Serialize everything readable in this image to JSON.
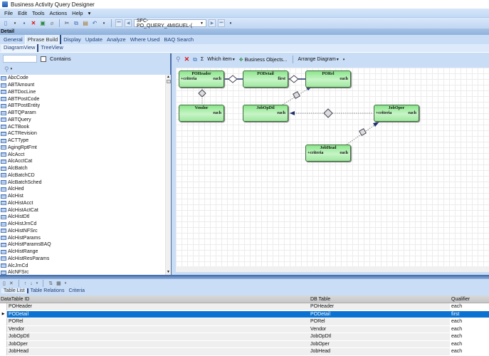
{
  "window": {
    "title": "Business Activity Query Designer"
  },
  "menu": [
    "File",
    "Edit",
    "Tools",
    "Actions",
    "Help"
  ],
  "toolbar": {
    "icons": [
      "new-icon",
      "save-icon",
      "delete-icon",
      "refresh-icon",
      "clear-icon",
      "cut-icon",
      "copy-icon",
      "paste-icon",
      "undo-icon"
    ],
    "query_select_value": "SFC-PO_QUERY_4MIGUEL-("
  },
  "detail_label": "Detail",
  "main_tabs": [
    {
      "label": "General",
      "active": false
    },
    {
      "label": "Phrase Build",
      "active": true
    },
    {
      "label": "Display",
      "active": false
    },
    {
      "label": "Update",
      "active": false
    },
    {
      "label": "Analyze",
      "active": false
    },
    {
      "label": "Where Used",
      "active": false
    },
    {
      "label": "BAQ Search",
      "active": false
    }
  ],
  "view_tabs": [
    {
      "label": "DiagramView",
      "active": true
    },
    {
      "label": "TreeView",
      "active": false
    }
  ],
  "left_panel": {
    "search_value": "",
    "contains_label": "Contains",
    "contains_checked": false,
    "tables": [
      "AbcCode",
      "ABTAmount",
      "ABTDocLine",
      "ABTPostCode",
      "ABTPostEntity",
      "ABTQParam",
      "ABTQuery",
      "ACTBook",
      "ACTRevision",
      "ACTType",
      "AgingRptFmt",
      "AlcAcct",
      "AlcAcctCat",
      "AlcBatch",
      "AlcBatchCD",
      "AlcBatchSched",
      "AlcHed",
      "AlcHist",
      "AlcHistAcct",
      "AlcHistActCat",
      "AlcHistDtl",
      "AlcHistJrnCd",
      "AlcHistNFSrc",
      "AlcHistParams",
      "AlcHistParamsBAQ",
      "AlcHistRange",
      "AlcHistResParams",
      "AlcJrnCd",
      "AlcNFSrc"
    ]
  },
  "canvas_toolbar": {
    "sum_symbol": "Σ",
    "which_item": "Which item",
    "business_objects": "Business Objects...",
    "arrange_diagram": "Arrange Diagram"
  },
  "diagram": {
    "nodes": [
      {
        "id": "POHeader",
        "title": "POHeader",
        "left": "+criteria",
        "right": "each"
      },
      {
        "id": "PODetail",
        "title": "PODetail",
        "left": "",
        "right": "first"
      },
      {
        "id": "PORel",
        "title": "PORel",
        "left": "",
        "right": "each"
      },
      {
        "id": "Vendor",
        "title": "Vendor",
        "left": "",
        "right": "each"
      },
      {
        "id": "JobOpDtl",
        "title": "JobOpDtl",
        "left": "",
        "right": "each"
      },
      {
        "id": "JobOper",
        "title": "JobOper",
        "left": "+criteria",
        "right": "each"
      },
      {
        "id": "JobHead",
        "title": "JobHead",
        "left": "+criteria",
        "right": "each"
      }
    ]
  },
  "bottom_tabs": [
    {
      "label": "Table List",
      "active": true
    },
    {
      "label": "Table Relations",
      "active": false
    },
    {
      "label": "Criteria",
      "active": false
    }
  ],
  "grid": {
    "headers": [
      "DataTable ID",
      "DB Table",
      "Qualifier"
    ],
    "rows": [
      {
        "id": "POHeader",
        "db": "POHeader",
        "q": "each",
        "selected": false
      },
      {
        "id": "PODetail",
        "db": "PODetail",
        "q": "first",
        "selected": true
      },
      {
        "id": "PORel",
        "db": "PORel",
        "q": "each",
        "selected": false
      },
      {
        "id": "Vendor",
        "db": "Vendor",
        "q": "each",
        "selected": false
      },
      {
        "id": "JobOpDtl",
        "db": "JobOpDtl",
        "q": "each",
        "selected": false
      },
      {
        "id": "JobOper",
        "db": "JobOper",
        "q": "each",
        "selected": false
      },
      {
        "id": "JobHead",
        "db": "JobHead",
        "q": "each",
        "selected": false
      }
    ]
  },
  "colors": {
    "selection": "#0a72d0",
    "node_fill": "#9fe89f",
    "ribbon": "#c9ddf6"
  }
}
